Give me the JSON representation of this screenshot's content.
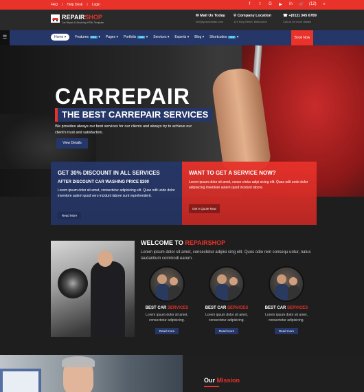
{
  "topbar": {
    "links": [
      "FAQ",
      "Help Desk",
      "Login"
    ],
    "social_icons": [
      "facebook-icon",
      "twitter-icon",
      "google-plus-icon",
      "youtube-icon",
      "linkedin-icon"
    ],
    "cart": "(12)"
  },
  "header": {
    "logo_prefix": "REPAIR",
    "logo_suffix": "SHOP",
    "logo_tagline": "Car Repair & Servicing HTML Template",
    "mail_title": "Mail Us Today",
    "mail_sub": "info@yourdomain.com",
    "location_title": "Company Location",
    "location_sub": "121 King Street, Melbourne",
    "phone_title": "+(012) 345 6789",
    "phone_sub": "Call us for more details"
  },
  "nav": {
    "items": [
      {
        "label": "Home",
        "badge": ""
      },
      {
        "label": "Features",
        "badge": "New"
      },
      {
        "label": "Pages",
        "badge": ""
      },
      {
        "label": "Portfolio",
        "badge": "New"
      },
      {
        "label": "Services",
        "badge": ""
      },
      {
        "label": "Experts",
        "badge": ""
      },
      {
        "label": "Blog",
        "badge": ""
      },
      {
        "label": "Shortcodes",
        "badge": "New"
      }
    ],
    "book": "Book Now"
  },
  "hero": {
    "title": "CARREPAIR",
    "subtitle": "THE BEST CARREPAIR SERVICES",
    "text": "We provides always our best services for our clients and always try to achieve our client's trust and satisfaction.",
    "button": "View Details"
  },
  "promo": {
    "left_title": "GET 30% DISCOUNT IN ALL SERVICES",
    "left_sub": "AFTER DISCOUNT CAR WASHING PRICE $200",
    "left_text": "Lorem ipsum dolor sit amet, consectetur adipisicing elit. Quas odit unde dolor inventore autem quod vero incidunt labore sunt reprehenderit.",
    "left_button": "Read More",
    "right_title": "WANT TO GET A SERVICE NOW?",
    "right_text": "Lorem ipsum dolor sit amet, conse ctetur adipi sicing elit. Quas odit unde dolor adipisicing inventore autem quod incidunt labore.",
    "right_button": "Get A Quote Now"
  },
  "welcome": {
    "title_prefix": "WELCOME TO ",
    "title_suffix": "REPAIRSHOP",
    "text": "Lorem ipsum dolor sit amet, consectetur adipisi cing elit. Quos odio rem consequ untur, natus laudantium commodi earum.",
    "services": [
      {
        "title_a": "BEST CAR ",
        "title_b": "SERVICES",
        "desc": "Lorem ipsum dolor sit amet, consectetur adipisicing.",
        "button": "Read more"
      },
      {
        "title_a": "BEST CAR ",
        "title_b": "SERVICES",
        "desc": "Lorem ipsum dolor sit amet, consectetur adipisicing.",
        "button": "Read more"
      },
      {
        "title_a": "BEST CAR ",
        "title_b": "SERVICES",
        "desc": "Lorem ipsum dolor sit amet, consectetur adipisicing.",
        "button": "Read more"
      }
    ]
  },
  "mission": {
    "prefix": "Our ",
    "suffix": "Mission"
  },
  "colors": {
    "accent": "#e8322a",
    "navy": "#253668",
    "dark": "#1e1e1e"
  }
}
